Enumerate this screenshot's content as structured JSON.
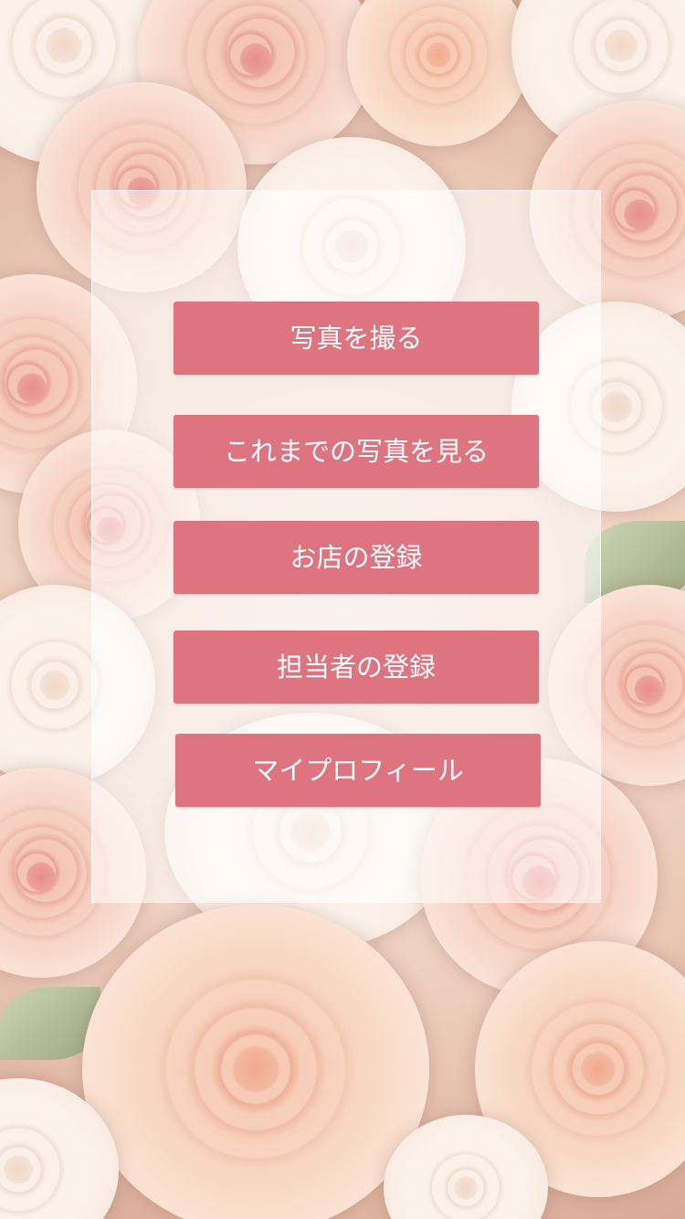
{
  "menu": {
    "items": [
      {
        "label": "写真を撮る"
      },
      {
        "label": "これまでの写真を見る"
      },
      {
        "label": "お店の登録"
      },
      {
        "label": "担当者の登録"
      },
      {
        "label": "マイプロフィール"
      }
    ]
  },
  "theme": {
    "button_color": "#de7480",
    "button_text_color": "#ffffff",
    "panel_color": "rgba(255,255,255,0.55)"
  },
  "background": {
    "image": "pink and cream roses photo"
  }
}
